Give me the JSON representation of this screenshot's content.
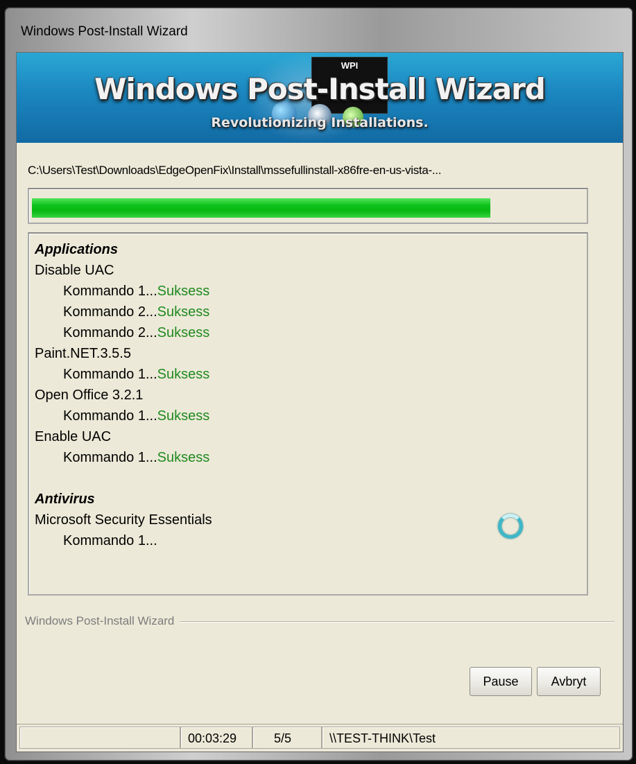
{
  "window": {
    "title": "Windows Post-Install Wizard"
  },
  "banner": {
    "badge": "WPI",
    "title": "Windows Post-Install Wizard",
    "subtitle": "Revolutionizing Installations."
  },
  "current_path": "C:\\Users\\Test\\Downloads\\EdgeOpenFix\\Install\\mssefullinstall-x86fre-en-us-vista-...",
  "progress": {
    "fraction": 0.83,
    "color": "#10c31c"
  },
  "log": {
    "success_color": "#208a20",
    "lines": [
      {
        "kind": "section",
        "text": "Applications"
      },
      {
        "kind": "item",
        "text": "Disable UAC"
      },
      {
        "kind": "sub",
        "text": "Kommando 1...",
        "status": "Suksess"
      },
      {
        "kind": "sub",
        "text": "Kommando 2...",
        "status": "Suksess"
      },
      {
        "kind": "sub",
        "text": "Kommando 2...",
        "status": "Suksess"
      },
      {
        "kind": "item",
        "text": "Paint.NET.3.5.5"
      },
      {
        "kind": "sub",
        "text": "Kommando 1...",
        "status": "Suksess"
      },
      {
        "kind": "item",
        "text": "Open Office 3.2.1"
      },
      {
        "kind": "sub",
        "text": "Kommando 1...",
        "status": "Suksess"
      },
      {
        "kind": "item",
        "text": "Enable UAC"
      },
      {
        "kind": "sub",
        "text": "Kommando 1...",
        "status": "Suksess"
      },
      {
        "kind": "blank",
        "text": ""
      },
      {
        "kind": "section",
        "text": "Antivirus"
      },
      {
        "kind": "item",
        "text": "Microsoft Security Essentials"
      },
      {
        "kind": "sub",
        "text": "Kommando 1...",
        "status": ""
      }
    ]
  },
  "groupbox": {
    "label": "Windows Post-Install Wizard"
  },
  "buttons": {
    "pause": "Pause",
    "abort": "Avbryt"
  },
  "statusbar": {
    "elapsed": "00:03:29",
    "count": "5/5",
    "user": "\\\\TEST-THINK\\Test"
  }
}
